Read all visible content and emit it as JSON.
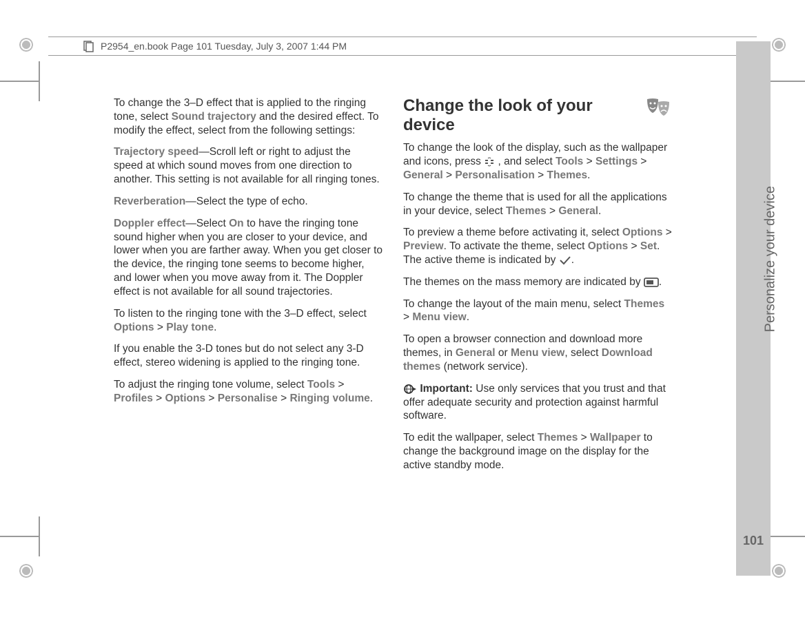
{
  "header": "P2954_en.book  Page 101  Tuesday, July 3, 2007  1:44 PM",
  "side_label": "Personalize your device",
  "page_number": "101",
  "left": {
    "p1a": "To change the 3–D effect that is applied to the ringing tone, select ",
    "p1b": "Sound trajectory",
    "p1c": " and the desired effect. To modify the effect, select from the following settings:",
    "p2a": "Trajectory speed",
    "p2b": "—Scroll left or right to adjust the speed at which sound moves from one direction to another. This setting is not available for all ringing tones.",
    "p3a": "Reverberation",
    "p3b": "—Select the type of echo.",
    "p4a": "Doppler effect",
    "p4b": "—Select ",
    "p4c": "On",
    "p4d": " to have the ringing tone sound higher when you are closer to your device, and lower when you are farther away. When you get closer to the device, the ringing tone seems to become higher, and lower when you move away from it. The Doppler effect is not available for all sound trajectories.",
    "p5a": "To listen to the ringing tone with the 3–D effect, select ",
    "p5b": "Options",
    "p5c": "Play tone",
    "p6": "If you enable the 3-D tones but do not select any 3-D effect, stereo widening is applied to the ringing tone.",
    "p7a": "To adjust the ringing tone volume, select ",
    "p7b": "Tools",
    "p7c": "Profiles",
    "p7d": "Options",
    "p7e": "Personalise",
    "p7f": "Ringing volume"
  },
  "right": {
    "h1": "Change the look of your device",
    "p1a": "To change the look of the display, such as the wallpaper and icons, press ",
    "p1b": ", and select ",
    "p1c": "Tools",
    "p1d": "Settings",
    "p1e": "General",
    "p1f": "Personalisation",
    "p1g": "Themes",
    "p2a": "To change the theme that is used for all the applications in your device, select ",
    "p2b": "Themes",
    "p2c": "General",
    "p3a": "To preview a theme before activating it, select ",
    "p3b": "Options",
    "p3c": "Preview",
    "p3d": ". To activate the theme, select ",
    "p3e": "Options",
    "p3f": "Set",
    "p3g": ". The active theme is indicated by ",
    "p4a": "The themes on the mass memory are indicated by ",
    "p5a": "To change the layout of the main menu, select ",
    "p5b": "Themes",
    "p5c": "Menu view",
    "p6a": "To open a browser connection and download more themes, in ",
    "p6b": "General",
    "p6c": " or ",
    "p6d": "Menu view",
    "p6e": ", select ",
    "p6f": "Download themes",
    "p6g": " (network service).",
    "p7a": "Important:",
    "p7b": " Use only services that you trust and that offer adequate security and protection against harmful software.",
    "p8a": "To edit the wallpaper, select ",
    "p8b": "Themes",
    "p8c": "Wallpaper",
    "p8d": " to change the background image on the display for the active standby mode."
  }
}
